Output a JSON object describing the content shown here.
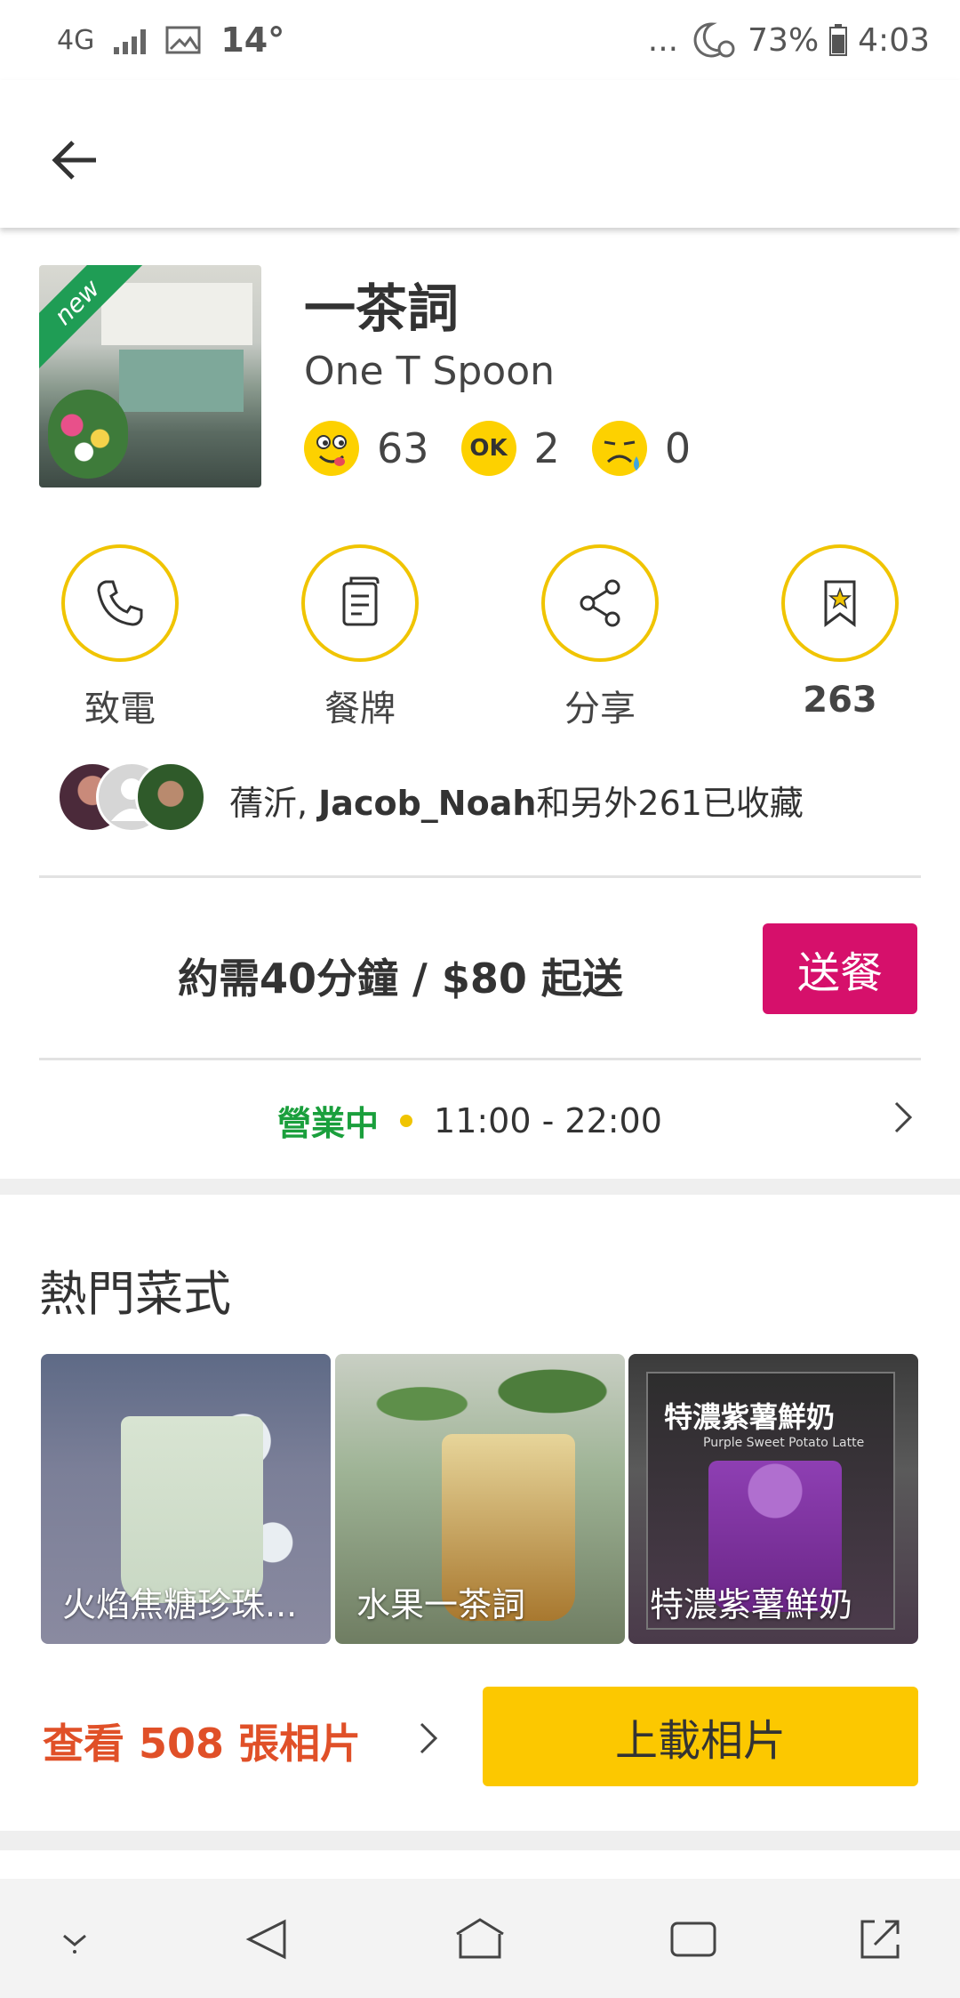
{
  "status_bar": {
    "network": "4G",
    "temperature": "14°",
    "overflow": "...",
    "battery": "73%",
    "time": "4:03"
  },
  "header": {
    "badge": "new",
    "name_zh": "一茶詞",
    "name_en": "One T Spoon",
    "ratings": {
      "good": "63",
      "ok_label": "OK",
      "ok": "2",
      "bad": "0"
    }
  },
  "actions": [
    {
      "label": "致電",
      "icon": "phone-icon"
    },
    {
      "label": "餐牌",
      "icon": "menu-icon"
    },
    {
      "label": "分享",
      "icon": "share-icon"
    },
    {
      "label": "263",
      "icon": "bookmark-icon"
    }
  ],
  "bookmarks": {
    "names_prefix": "蒨沂, ",
    "names_bold": "Jacob_Noah",
    "suffix": "和另外261已收藏"
  },
  "delivery": {
    "info": "約需40分鐘 / $80 起送",
    "button_label": "送餐"
  },
  "hours": {
    "status": "營業中",
    "time": "11:00 - 22:00"
  },
  "popular": {
    "title": "熱門菜式",
    "dishes": [
      {
        "name": "火焰焦糖珍珠..."
      },
      {
        "name": "水果一茶詞"
      },
      {
        "name": "特濃紫薯鮮奶",
        "sign_title": "特濃紫薯鮮奶",
        "sign_sub": "Purple Sweet Potato Latte"
      }
    ]
  },
  "photos": {
    "view_label": "查看 508 張相片",
    "upload_label": "上載相片"
  },
  "colors": {
    "accent_yellow": "#fcc800",
    "delivery_pink": "#d6106b",
    "open_green": "#1a9f3c",
    "photos_orange": "#e05028"
  }
}
